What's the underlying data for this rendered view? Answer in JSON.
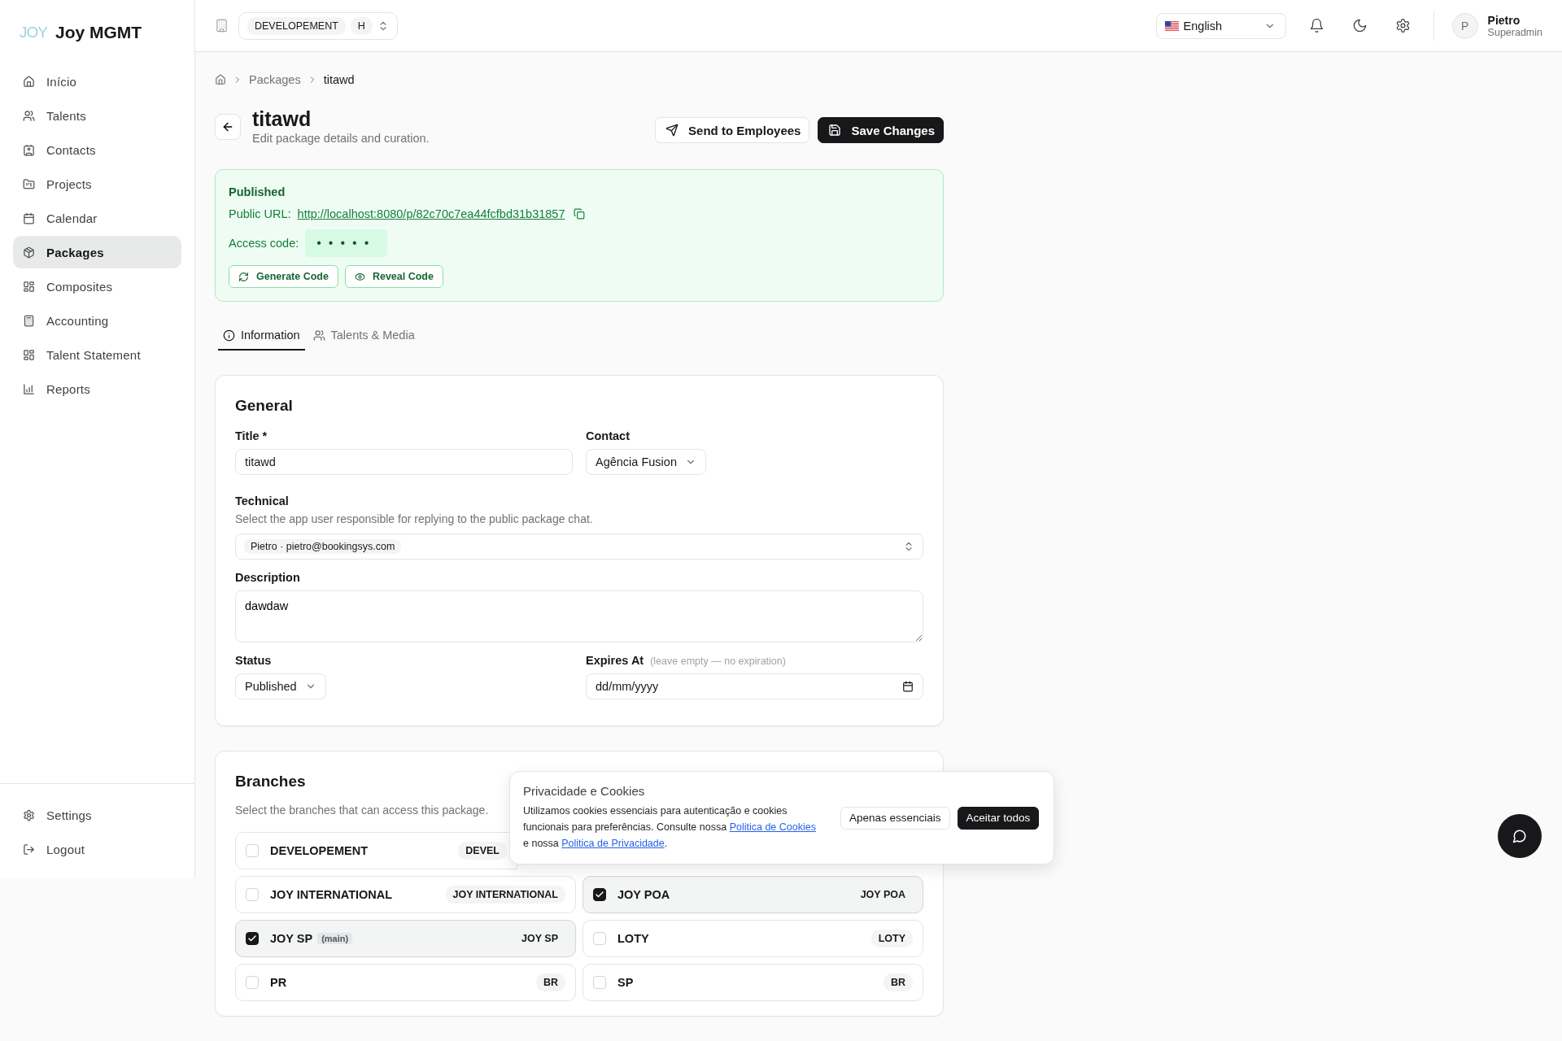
{
  "app": {
    "logo_mark": "JOY",
    "name": "Joy MGMT"
  },
  "sidebar": {
    "items": [
      {
        "label": "Início",
        "selected": false
      },
      {
        "label": "Talents",
        "selected": false
      },
      {
        "label": "Contacts",
        "selected": false
      },
      {
        "label": "Projects",
        "selected": false
      },
      {
        "label": "Calendar",
        "selected": false
      },
      {
        "label": "Packages",
        "selected": true
      },
      {
        "label": "Composites",
        "selected": false
      },
      {
        "label": "Accounting",
        "selected": false
      },
      {
        "label": "Talent Statement",
        "selected": false
      },
      {
        "label": "Reports",
        "selected": false
      }
    ],
    "footer_items": [
      {
        "label": "Settings"
      },
      {
        "label": "Logout"
      }
    ]
  },
  "topbar": {
    "branch_chips": [
      "DEVELOPEMENT",
      "H"
    ],
    "language": "English",
    "user": {
      "initial": "P",
      "name": "Pietro",
      "role": "Superadmin"
    }
  },
  "breadcrumb": [
    "Packages",
    "titawd"
  ],
  "header": {
    "title": "titawd",
    "subtitle": "Edit package details and curation.",
    "buttons": [
      "Send to Employees",
      "Save Changes"
    ]
  },
  "publish_panel": {
    "status": "Published",
    "url_label": "Public URL:",
    "url": "http://localhost:8080/p/82c70c7ea44fcfbd31b31857",
    "code_label": "Access code:",
    "code": "•••••",
    "buttons": [
      "Generate Code",
      "Reveal Code"
    ]
  },
  "tabs": [
    {
      "label": "Information",
      "selected": true
    },
    {
      "label": "Talents & Media",
      "selected": false
    }
  ],
  "general": {
    "heading": "General",
    "title": {
      "label": "Title *",
      "value": "titawd"
    },
    "contact": {
      "label": "Contact",
      "value": "Agência Fusion"
    },
    "technical": {
      "label": "Technical",
      "hint": "Select the app user responsible for replying to the public package chat.",
      "value": "Pietro · pietro@bookingsys.com"
    },
    "description": {
      "label": "Description",
      "value": "dawdaw"
    },
    "status": {
      "label": "Status",
      "value": "Published"
    },
    "expires": {
      "label": "Expires At",
      "note": "(leave empty — no expiration)",
      "placeholder": "dd/mm/yyyy"
    }
  },
  "branches": {
    "heading": "Branches",
    "hint": "Select the branches that can access this package.",
    "items": [
      {
        "name": "DEVELOPEMENT",
        "tag": "DEVEL",
        "checked": false
      },
      {
        "name": "JOY INTERNATIONAL",
        "tag": "JOY INTERNATIONAL",
        "checked": false
      },
      {
        "name": "JOY POA",
        "tag": "JOY POA",
        "checked": true
      },
      {
        "name": "JOY SP",
        "note": "(main)",
        "tag": "JOY SP",
        "checked": true
      },
      {
        "name": "LOTY",
        "tag": "LOTY",
        "checked": false
      },
      {
        "name": "PR",
        "tag": "BR",
        "checked": false
      },
      {
        "name": "SP",
        "tag": "BR",
        "checked": false
      }
    ]
  },
  "cookie_banner": {
    "title": "Privacidade e Cookies",
    "text_start": "Utilizamos cookies essenciais para autenticação e cookies funcionais para preferências. Consulte nossa",
    "link_cookies": "Politica de Cookies",
    "text_middle": "e nossa",
    "link_privacy": "Politica de Privacidade",
    "text_end": ".",
    "buttons": [
      "Apenas essenciais",
      "Aceitar todos"
    ]
  }
}
